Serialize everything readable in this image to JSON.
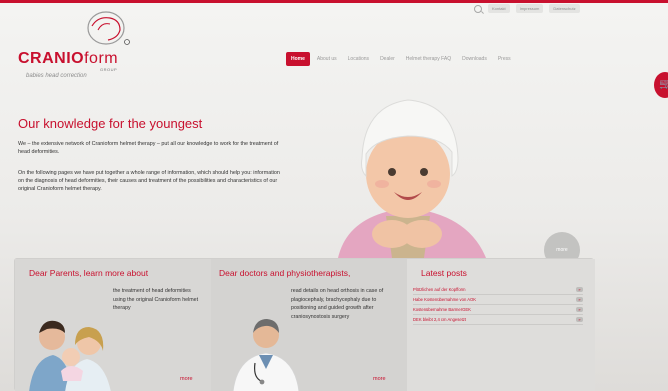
{
  "toolbar": {
    "items": [
      "Kontakt",
      "Impressum",
      "Datenschutz"
    ]
  },
  "logo": {
    "brand_a": "CRANIO",
    "brand_b": "form",
    "group": "GROUP",
    "tagline": "babies head correction"
  },
  "nav": {
    "items": [
      "Home",
      "About us",
      "Locations",
      "Dealer",
      "Helmet therapy FAQ",
      "Downloads",
      "Press"
    ]
  },
  "hero": {
    "title": "Our knowledge for the youngest",
    "text1": "We – the extensive network of Cranioform helmet therapy – put all our knowledge to work for the treatment of head deformities.",
    "text2": "On the following pages we have put together a whole range of information, which should help you: information on the diagnosis of head deformities, their causes and treatment of the possibilities and characteristics of our original Cranioform helmet therapy.",
    "more_label": "more"
  },
  "cart_glyph": "🛒",
  "panel": {
    "parents": {
      "title": "Dear Parents, learn more about",
      "text": "the treatment of head deformities using the original Cranioform helmet therapy",
      "more": "more"
    },
    "doctors": {
      "title": "Dear doctors and physiotherapists,",
      "text": "read details on head orthosis in case of plagiocephaly, brachycephaly due to positioning and guided growth after craniosynostosis surgery",
      "more": "more"
    },
    "latest": {
      "title": "Latest posts",
      "posts": [
        "Plötzlichen auf der Kopfform",
        "Habe Kostenübernahme von AOK",
        "Kostenübernahme BarmerGEK",
        "DEK bleibt 2,4 cm Angesetzt"
      ],
      "arrow": "»"
    }
  }
}
